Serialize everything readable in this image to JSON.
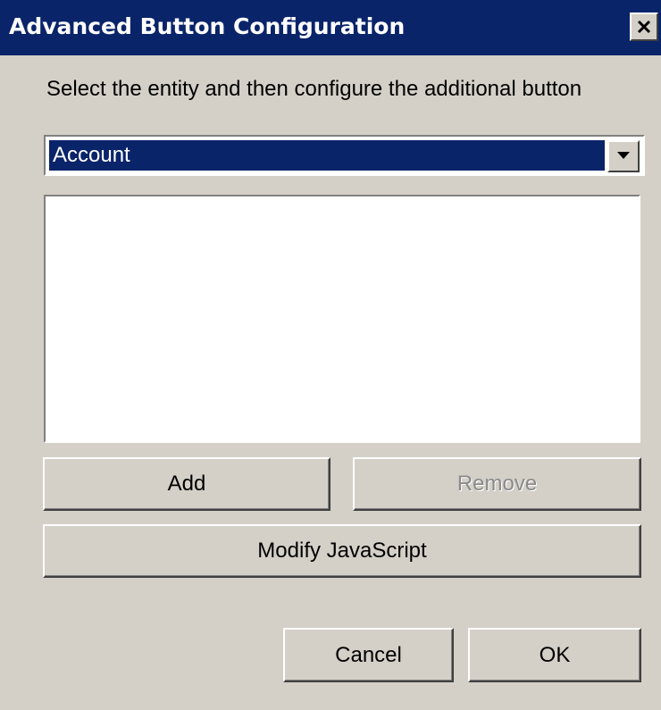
{
  "window": {
    "title": "Advanced Button Configuration",
    "close_icon": "close-icon"
  },
  "instruction": "Select the entity and then configure the additional button",
  "entity_select": {
    "selected": "Account",
    "arrow_icon": "chevron-down-icon"
  },
  "button_list": {
    "items": []
  },
  "buttons": {
    "add": "Add",
    "remove": "Remove",
    "modify_js": "Modify JavaScript",
    "cancel": "Cancel",
    "ok": "OK"
  },
  "colors": {
    "titlebar": "#0a246a",
    "dialog_bg": "#d4d0c8",
    "selection": "#0a246a"
  }
}
